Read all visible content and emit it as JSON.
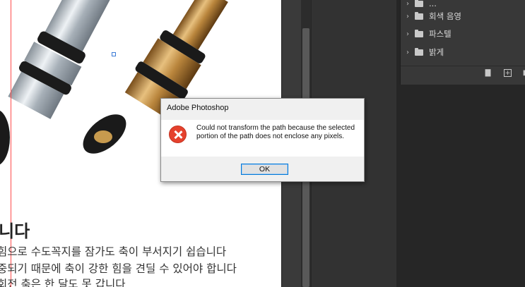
{
  "canvas": {
    "headline": "습니다",
    "body_lines": [
      "힘으로 수도꼭지를 잠가도 축이 부서지기 쉽습니다",
      "중되기 때문에 축이 강한 힘을 견딜 수 있어야 합니다",
      "회전 축은 한 달도 못 갑니다"
    ]
  },
  "layers": {
    "items": [
      {
        "label": "..."
      },
      {
        "label": "회색 음영"
      },
      {
        "label": "파스텔"
      },
      {
        "label": "밝게"
      }
    ]
  },
  "dialog": {
    "title": "Adobe Photoshop",
    "message": "Could not transform the path because the selected portion of the path does not enclose any pixels.",
    "ok_label": "OK"
  },
  "colors": {
    "guide": "#ff4b4b",
    "error": "#e5412d",
    "button_focus": "#0078d7"
  }
}
